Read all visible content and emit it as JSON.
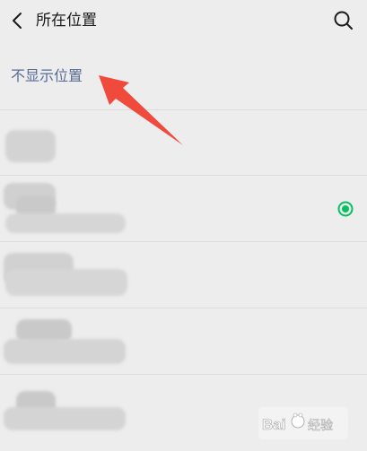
{
  "header": {
    "title": "所在位置",
    "back_icon": "chevron-left-icon",
    "search_icon": "search-icon"
  },
  "no_location": {
    "label": "不显示位置"
  },
  "location_items": [
    {
      "name": "",
      "address": "",
      "selected": false
    },
    {
      "name": "",
      "address": "",
      "selected": true
    },
    {
      "name": "",
      "address": "",
      "selected": false
    },
    {
      "name": "",
      "address": "",
      "selected": false
    },
    {
      "name": "",
      "address": "",
      "selected": false
    }
  ],
  "colors": {
    "background": "#ededed",
    "link": "#576b95",
    "selected": "#07c160",
    "arrow": "#f04a3c"
  }
}
